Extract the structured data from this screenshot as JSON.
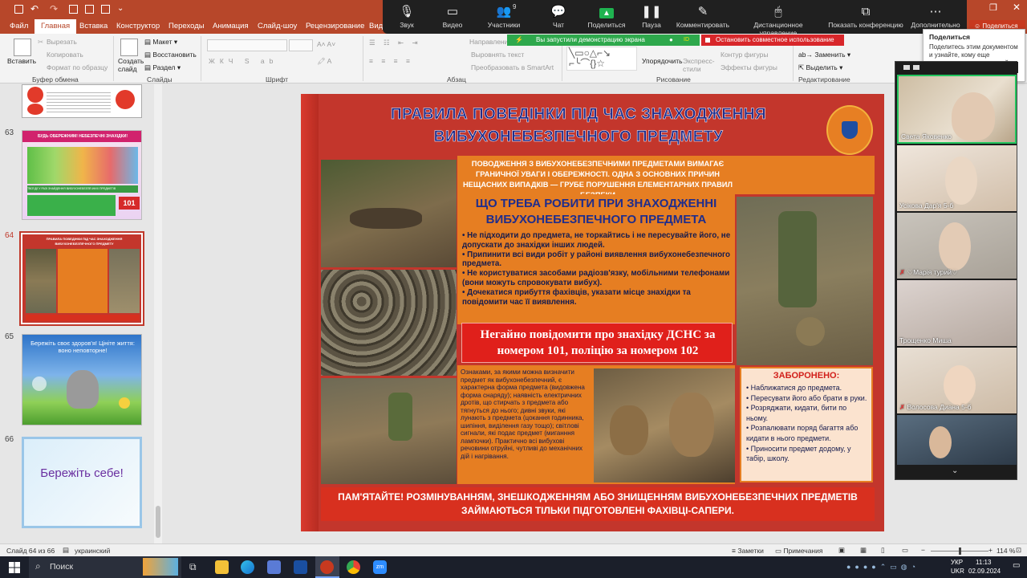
{
  "ribbon_tabs": [
    "Файл",
    "Главная",
    "Вставка",
    "Конструктор",
    "Переходы",
    "Анимация",
    "Слайд-шоу",
    "Рецензирование",
    "Вид"
  ],
  "active_tab": "Главная",
  "ribbon": {
    "paste": "Вставить",
    "cut": "Вырезать",
    "copy": "Копировать",
    "format_painter": "Формат по образцу",
    "clipboard_group": "Буфер обмена",
    "new_slide": "Создать слайд",
    "layout": "Макет",
    "reset": "Восстановить",
    "section": "Раздел",
    "slides_group": "Слайды",
    "font_group": "Шрифт",
    "direction": "Направлени",
    "align_text": "Выровнять текст",
    "smartart": "Преобразовать в SmartArt",
    "paragraph_group": "Абзац",
    "arrange": "Упорядочить",
    "express": "Экспресс-стили",
    "shape_outline": "Контур фигуры",
    "shape_effects": "Эффекты фигуры",
    "drawing_group": "Рисование",
    "replace": "Заменить",
    "select": "Выделить",
    "editing_group": "Редактирование"
  },
  "zoom_bar": {
    "buttons": [
      {
        "label": "Звук",
        "icon": "mic-icon"
      },
      {
        "label": "Видео",
        "icon": "camera-icon"
      },
      {
        "label": "Участники",
        "icon": "people-icon",
        "count": "9"
      },
      {
        "label": "Чат",
        "icon": "chat-icon"
      },
      {
        "label": "Поделиться",
        "icon": "share-icon"
      },
      {
        "label": "Пауза",
        "icon": "pause-icon"
      },
      {
        "label": "Комментировать",
        "icon": "pen-icon"
      },
      {
        "label": "Дистанционное управление",
        "icon": "mouse-icon"
      },
      {
        "label": "Показать конференцию",
        "icon": "window-icon"
      },
      {
        "label": "Дополнительно",
        "icon": "more-icon"
      }
    ],
    "sharing_banner": "Вы запустили демонстрацию экрана",
    "sharing_id": "ID",
    "stop_share": "Остановить совместное использование",
    "share_button": "Поделиться"
  },
  "tooltip": {
    "title": "Поделиться",
    "text": "Поделитесь этим документом и узнайте, кому еще предоставлен совместный доступ к нему."
  },
  "thumbnails": [
    {
      "num": "63",
      "text": "БУДЬ ОБЕРЕЖНИМ! НЕБЕЗПЕЧНІ ЗНАХІДКИ!",
      "caption": "ТВОЇ ДІЇ У РАЗІ ЗНАЙДЕННЯ ВИБУХОНЕБЕЗПЕЧНИХ ПРЕДМЕТІВ",
      "badge": "101"
    },
    {
      "num": "64",
      "text": "ПРАВИЛА ПОВЕДІНКИ ПІД ЧАС ЗНАХОДЖЕННЯ ВИБУХОНЕБЕЗПЕЧНОГО ПРЕДМЕТУ"
    },
    {
      "num": "65",
      "text": "Бережіть своє здоров'я! Цініте життя: воно неповторне!"
    },
    {
      "num": "66",
      "text": "Бережіть себе!"
    }
  ],
  "slide": {
    "title1": "ПРАВИЛА ПОВЕДІНКИ ПІД ЧАС ЗНАХОДЖЕННЯ",
    "title2": "ВИБУХОНЕБЕЗПЕЧНОГО ПРЕДМЕТУ",
    "intro": "ПОВОДЖЕННЯ З ВИБУХОНЕБЕЗПЕЧНИМИ ПРЕДМЕТАМИ ВИМАГАЄ ГРАНИЧНОЇ УВАГИ І ОБЕРЕЖНОСТІ. ОДНА З ОСНОВНИХ ПРИЧИН НЕЩАСНИХ ВИПАДКІВ — ГРУБЕ ПОРУШЕННЯ ЕЛЕМЕНТАРНИХ ПРАВИЛ БЕЗПЕКИ",
    "what_title1": "ЩО ТРЕБА РОБИТИ ПРИ ЗНАХОДЖЕННІ",
    "what_title2": "ВИБУХОНЕБЕЗПЕЧНОГО ПРЕДМЕТА",
    "steps": [
      "Не підходити до предмета, не торкайтись і не пересувайте його, не допускати до знахідки інших людей.",
      "Припинити всі види робіт у районі виявлення вибухонебезпечного предмета.",
      "Не користуватися засобами радіозв'язку, мобільними телефонами (вони можуть спровокувати вибух).",
      "Дочекатися прибуття фахівців, указати місце знахідки та повідомити час її виявлення."
    ],
    "call": "Негайно повідомити про знахідку ДСНС за номером 101, поліцію за номером 102",
    "signs": "Ознаками, за якими можна визначити предмет як вибухонебезпечний, є характерна форма предмета (видовжена форма снаряду); наявність електричних дротів, що стирчать з предмета або тягнуться до нього; дивні звуки, які лунають з предмета (цокання годинника, шипіння, виділення газу тощо); світлові сигнали, які подає предмет (миганння лампочки). Практично всі вибухові речовини отруйні, чутливі до механічних дій і нагрівання.",
    "forbidden_title": "ЗАБОРОНЕНО:",
    "forbidden": [
      "Наближатися до предмета.",
      "Пересувати його або брати в руки.",
      "Розряджати, кидати, бити по ньому.",
      "Розпалювати поряд багаття або кидати в нього предмети.",
      "Приносити предмет додому, у табір, школу."
    ],
    "footer": "ПАМ'ЯТАЙТЕ! РОЗМІНУВАННЯМ, ЗНЕШКОДЖЕННЯМ АБО ЗНИЩЕННЯМ ВИБУХОНЕБЕЗПЕЧНИХ ПРЕДМЕТІВ ЗАЙМАЮТЬСЯ ТІЛЬКИ ПІДГОТОВЛЕНІ ФАХІВЦІ-САПЕРИ."
  },
  "participants": [
    "Света Яковенко",
    "Усікова Дар'я 5-б",
    "Марія турий",
    "Трощенко Миша",
    "Волосова Диана 5-б"
  ],
  "status": {
    "slide_info": "Слайд 64 из 66",
    "language": "украинский",
    "notes": "Заметки",
    "comments": "Примечания",
    "zoom": "114 %"
  },
  "taskbar": {
    "search": "Поиск",
    "lang1": "УКР",
    "lang2": "UKR",
    "time": "11:13",
    "date": "02.09.2024"
  }
}
